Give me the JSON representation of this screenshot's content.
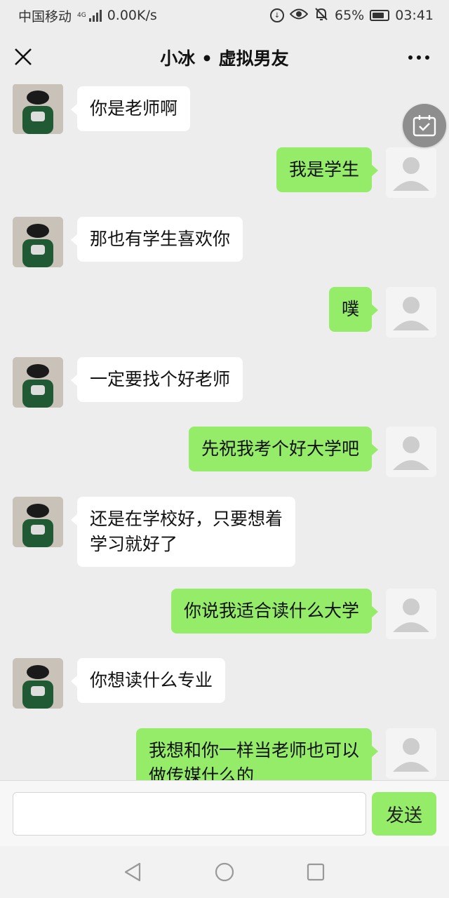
{
  "status": {
    "carrier": "中国移动",
    "network": "4G",
    "speed": "0.00K/s",
    "battery": "65%",
    "time": "03:41"
  },
  "header": {
    "title": "小冰 • 虚拟男友"
  },
  "messages": [
    {
      "sender": "bot",
      "text": "你是老师啊"
    },
    {
      "sender": "user",
      "text": "我是学生"
    },
    {
      "sender": "bot",
      "text": "那也有学生喜欢你"
    },
    {
      "sender": "user",
      "text": "噗"
    },
    {
      "sender": "bot",
      "text": "一定要找个好老师"
    },
    {
      "sender": "user",
      "text": "先祝我考个好大学吧"
    },
    {
      "sender": "bot",
      "text": "还是在学校好，只要想着\n学习就好了"
    },
    {
      "sender": "user",
      "text": "你说我适合读什么大学"
    },
    {
      "sender": "bot",
      "text": "你想读什么专业"
    },
    {
      "sender": "user",
      "text": "我想和你一样当老师也可以\n做传媒什么的"
    }
  ],
  "composer": {
    "value": "",
    "send_label": "发送"
  },
  "colors": {
    "user_bubble": "#95ec69",
    "bot_bubble": "#ffffff",
    "background": "#ededed"
  }
}
